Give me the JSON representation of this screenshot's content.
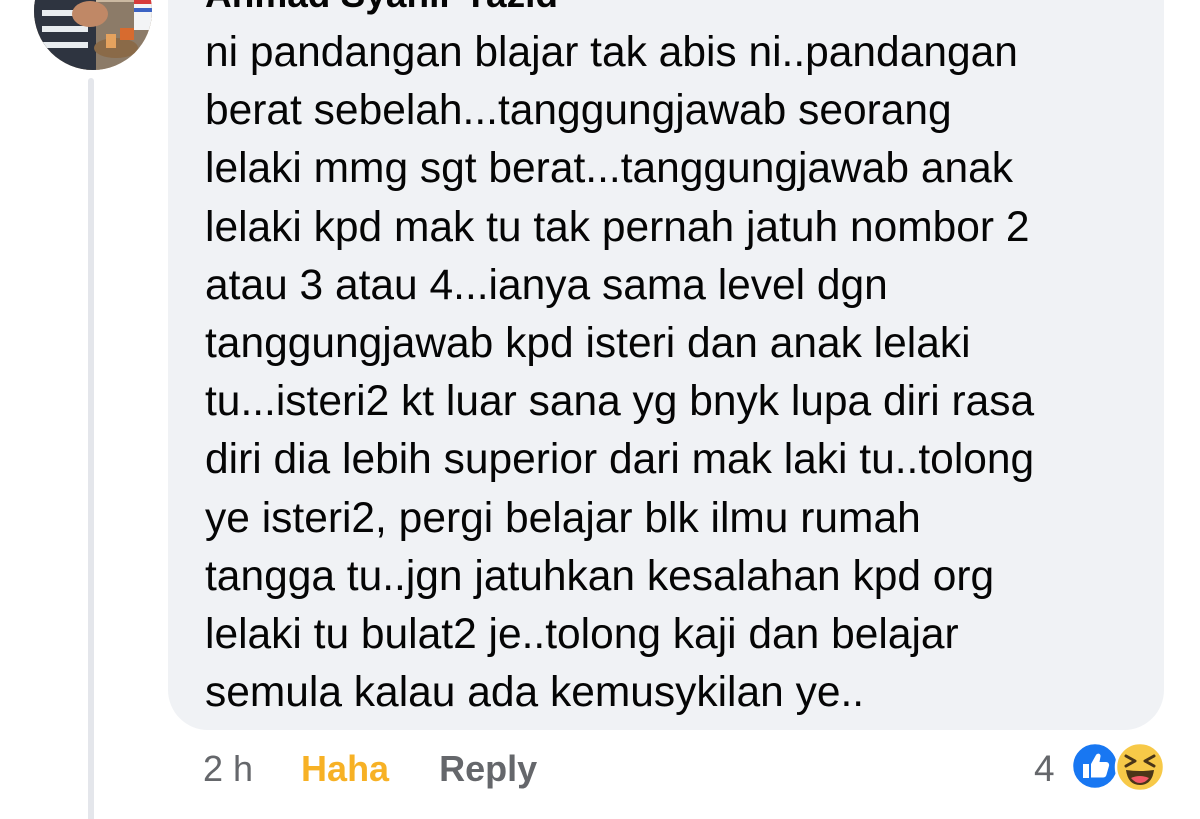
{
  "comment": {
    "author": "Ahmad Syahir Yazid",
    "lines": [
      "ni pandangan blajar tak abis ni..pandangan",
      "berat sebelah...tanggungjawab seorang",
      "lelaki mmg sgt berat...tanggungjawab anak",
      "lelaki kpd mak tu tak pernah jatuh nombor 2",
      "atau 3 atau 4...ianya sama level dgn",
      "tanggungjawab kpd isteri dan anak lelaki",
      "tu...isteri2 kt luar sana yg bnyk lupa diri rasa",
      "diri dia lebih superior dari mak laki tu..tolong",
      "ye isteri2, pergi belajar blk ilmu rumah",
      "tangga tu..jgn jatuhkan kesalahan kpd org",
      "lelaki tu bulat2 je..tolong kaji dan belajar",
      "semula kalau ada kemusykilan ye.."
    ]
  },
  "meta": {
    "timestamp": "2 h",
    "reaction_label": "Haha",
    "reply_label": "Reply",
    "reaction_count": "4",
    "reaction_icons": [
      "like-icon",
      "haha-icon"
    ]
  },
  "colors": {
    "bubble": "#f0f2f5",
    "text": "#050505",
    "secondary": "#65676b",
    "haha": "#f7b125",
    "like": "#1877f2"
  }
}
